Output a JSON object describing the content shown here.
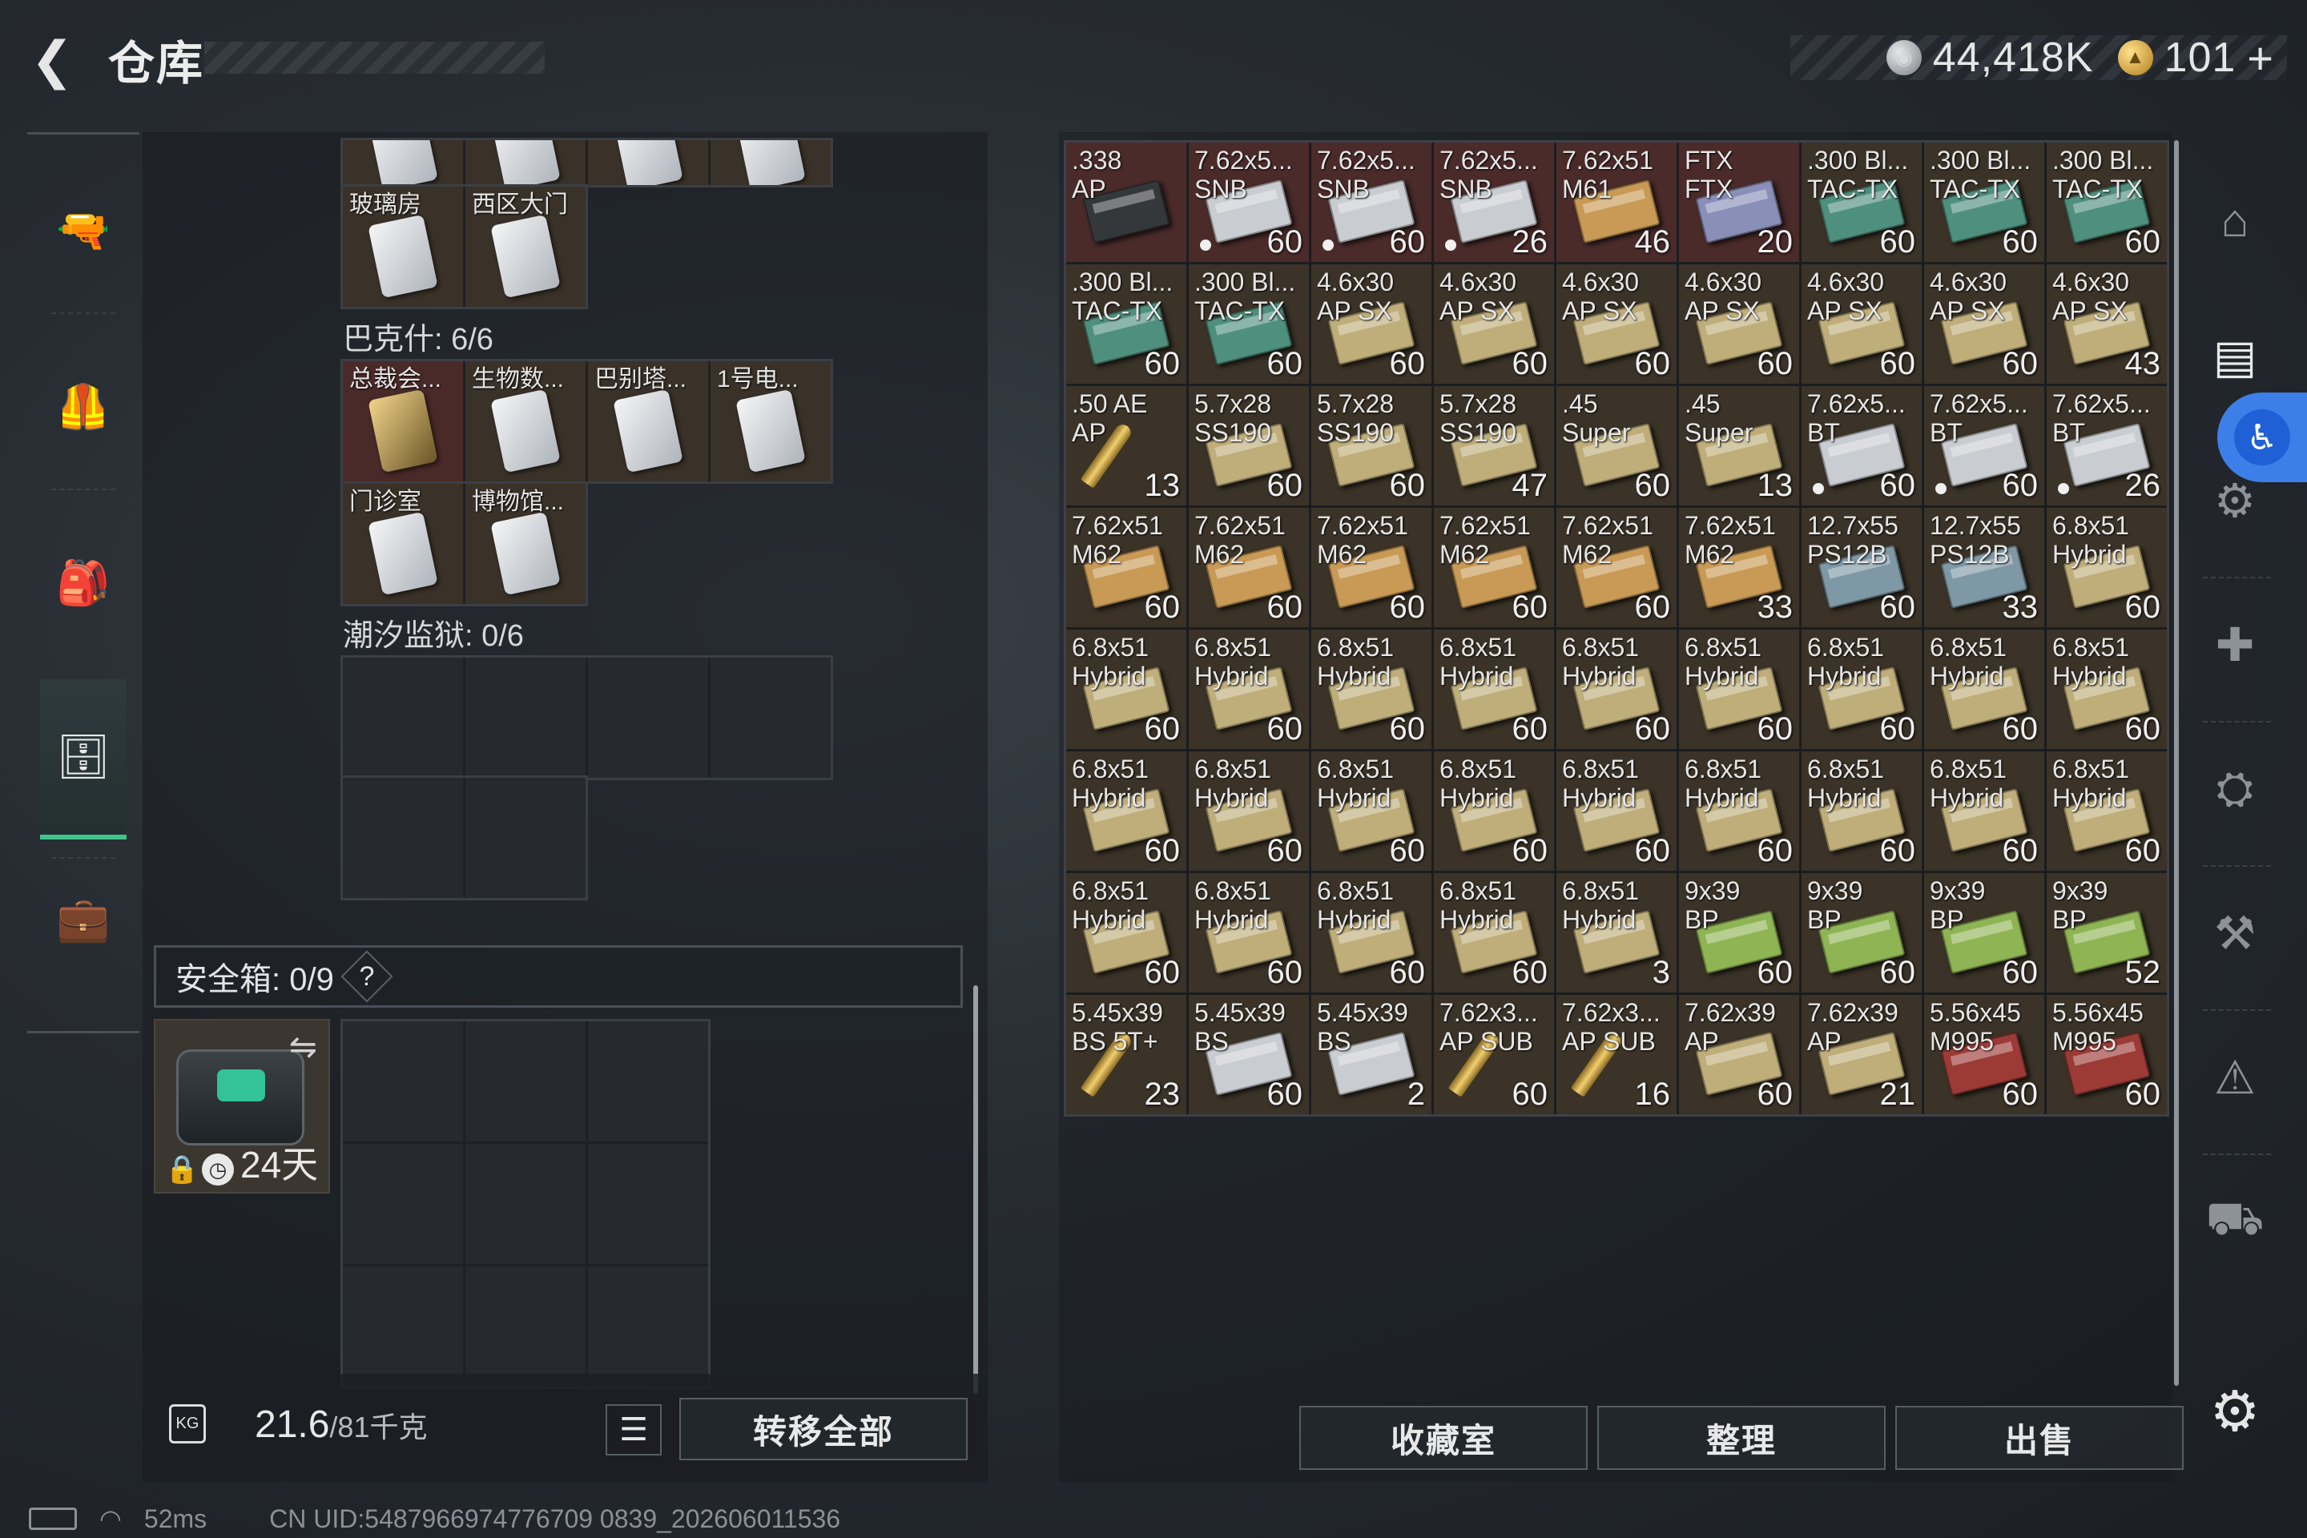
{
  "header": {
    "back_icon": "chevron-left-icon",
    "title": "仓库"
  },
  "currency": {
    "silver_amount": "44,418K",
    "gold_amount": "101",
    "add_label": "+"
  },
  "left_nav": {
    "items": [
      {
        "name": "weapon",
        "icon": "🔫"
      },
      {
        "name": "armor",
        "icon": "🦺"
      },
      {
        "name": "backpack",
        "icon": "🎒"
      },
      {
        "name": "container",
        "icon": "🗄"
      },
      {
        "name": "case",
        "icon": "💼"
      }
    ]
  },
  "keycards": {
    "top_row_labels": [
      "",
      "",
      "",
      ""
    ],
    "row2": [
      "玻璃房",
      "西区大门"
    ],
    "bakshi_label": "巴克什: 6/6",
    "bakshi_row1": [
      "总裁会...",
      "生物数...",
      "巴别塔...",
      "1号电..."
    ],
    "bakshi_row2": [
      "门诊室",
      "博物馆..."
    ],
    "prison_label": "潮汐监狱: 0/6"
  },
  "safe": {
    "label": "安全箱:  0/9",
    "help": "?",
    "days": "24天",
    "swap_icon": "⇋",
    "lock_icon": "🔒",
    "clock_icon": "◷"
  },
  "bottom_left": {
    "weight_icon": "KG",
    "weight_value": "21.6",
    "weight_total": "/81千克",
    "list_icon": "☰",
    "transfer_all": "转移全部"
  },
  "bottom_right": {
    "collection": "收藏室",
    "organize": "整理",
    "sell": "出售"
  },
  "ammo_rows": [
    [
      {
        "l1": ".338",
        "l2": "AP",
        "c": "",
        "k": "dark",
        "red": true
      },
      {
        "l1": "7.62x5...",
        "l2": "SNB",
        "c": "60",
        "k": "silver",
        "red": true,
        "dot": true
      },
      {
        "l1": "7.62x5...",
        "l2": "SNB",
        "c": "60",
        "k": "silver",
        "red": true,
        "dot": true
      },
      {
        "l1": "7.62x5...",
        "l2": "SNB",
        "c": "26",
        "k": "silver",
        "red": true,
        "dot": true
      },
      {
        "l1": "7.62x51",
        "l2": "M61",
        "c": "46",
        "k": "tan",
        "red": true
      },
      {
        "l1": "FTX",
        "l2": "FTX",
        "c": "20",
        "k": "blue",
        "red": true
      },
      {
        "l1": ".300 Bl...",
        "l2": "TAC-TX",
        "c": "60",
        "k": "teal"
      },
      {
        "l1": ".300 Bl...",
        "l2": "TAC-TX",
        "c": "60",
        "k": "teal"
      },
      {
        "l1": ".300 Bl...",
        "l2": "TAC-TX",
        "c": "60",
        "k": "teal"
      }
    ],
    [
      {
        "l1": ".300 Bl...",
        "l2": "TAC-TX",
        "c": "60",
        "k": "teal"
      },
      {
        "l1": ".300 Bl...",
        "l2": "TAC-TX",
        "c": "60",
        "k": "teal"
      },
      {
        "l1": "4.6x30",
        "l2": "AP SX",
        "c": "60",
        "k": "khaki"
      },
      {
        "l1": "4.6x30",
        "l2": "AP SX",
        "c": "60",
        "k": "khaki"
      },
      {
        "l1": "4.6x30",
        "l2": "AP SX",
        "c": "60",
        "k": "khaki"
      },
      {
        "l1": "4.6x30",
        "l2": "AP SX",
        "c": "60",
        "k": "khaki"
      },
      {
        "l1": "4.6x30",
        "l2": "AP SX",
        "c": "60",
        "k": "khaki"
      },
      {
        "l1": "4.6x30",
        "l2": "AP SX",
        "c": "60",
        "k": "khaki"
      },
      {
        "l1": "4.6x30",
        "l2": "AP SX",
        "c": "43",
        "k": "khaki"
      }
    ],
    [
      {
        "l1": ".50 AE",
        "l2": "AP",
        "c": "13",
        "k": "bullet"
      },
      {
        "l1": "5.7x28",
        "l2": "SS190",
        "c": "60",
        "k": "khaki"
      },
      {
        "l1": "5.7x28",
        "l2": "SS190",
        "c": "60",
        "k": "khaki"
      },
      {
        "l1": "5.7x28",
        "l2": "SS190",
        "c": "47",
        "k": "khaki"
      },
      {
        "l1": ".45",
        "l2": "Super",
        "c": "60",
        "k": "khaki"
      },
      {
        "l1": ".45",
        "l2": "Super",
        "c": "13",
        "k": "khaki"
      },
      {
        "l1": "7.62x5...",
        "l2": "BT",
        "c": "60",
        "k": "silver",
        "dot": true
      },
      {
        "l1": "7.62x5...",
        "l2": "BT",
        "c": "60",
        "k": "silver",
        "dot": true
      },
      {
        "l1": "7.62x5...",
        "l2": "BT",
        "c": "26",
        "k": "silver",
        "dot": true
      }
    ],
    [
      {
        "l1": "7.62x51",
        "l2": "M62",
        "c": "60",
        "k": "tan"
      },
      {
        "l1": "7.62x51",
        "l2": "M62",
        "c": "60",
        "k": "tan"
      },
      {
        "l1": "7.62x51",
        "l2": "M62",
        "c": "60",
        "k": "tan"
      },
      {
        "l1": "7.62x51",
        "l2": "M62",
        "c": "60",
        "k": "tan"
      },
      {
        "l1": "7.62x51",
        "l2": "M62",
        "c": "60",
        "k": "tan"
      },
      {
        "l1": "7.62x51",
        "l2": "M62",
        "c": "33",
        "k": "tan"
      },
      {
        "l1": "12.7x55",
        "l2": "PS12B",
        "c": "60",
        "k": "steel"
      },
      {
        "l1": "12.7x55",
        "l2": "PS12B",
        "c": "33",
        "k": "steel"
      },
      {
        "l1": "6.8x51",
        "l2": "Hybrid",
        "c": "60",
        "k": "khaki"
      }
    ],
    [
      {
        "l1": "6.8x51",
        "l2": "Hybrid",
        "c": "60",
        "k": "khaki"
      },
      {
        "l1": "6.8x51",
        "l2": "Hybrid",
        "c": "60",
        "k": "khaki"
      },
      {
        "l1": "6.8x51",
        "l2": "Hybrid",
        "c": "60",
        "k": "khaki"
      },
      {
        "l1": "6.8x51",
        "l2": "Hybrid",
        "c": "60",
        "k": "khaki"
      },
      {
        "l1": "6.8x51",
        "l2": "Hybrid",
        "c": "60",
        "k": "khaki"
      },
      {
        "l1": "6.8x51",
        "l2": "Hybrid",
        "c": "60",
        "k": "khaki"
      },
      {
        "l1": "6.8x51",
        "l2": "Hybrid",
        "c": "60",
        "k": "khaki"
      },
      {
        "l1": "6.8x51",
        "l2": "Hybrid",
        "c": "60",
        "k": "khaki"
      },
      {
        "l1": "6.8x51",
        "l2": "Hybrid",
        "c": "60",
        "k": "khaki"
      }
    ],
    [
      {
        "l1": "6.8x51",
        "l2": "Hybrid",
        "c": "60",
        "k": "khaki"
      },
      {
        "l1": "6.8x51",
        "l2": "Hybrid",
        "c": "60",
        "k": "khaki"
      },
      {
        "l1": "6.8x51",
        "l2": "Hybrid",
        "c": "60",
        "k": "khaki"
      },
      {
        "l1": "6.8x51",
        "l2": "Hybrid",
        "c": "60",
        "k": "khaki"
      },
      {
        "l1": "6.8x51",
        "l2": "Hybrid",
        "c": "60",
        "k": "khaki"
      },
      {
        "l1": "6.8x51",
        "l2": "Hybrid",
        "c": "60",
        "k": "khaki"
      },
      {
        "l1": "6.8x51",
        "l2": "Hybrid",
        "c": "60",
        "k": "khaki"
      },
      {
        "l1": "6.8x51",
        "l2": "Hybrid",
        "c": "60",
        "k": "khaki"
      },
      {
        "l1": "6.8x51",
        "l2": "Hybrid",
        "c": "60",
        "k": "khaki"
      }
    ],
    [
      {
        "l1": "6.8x51",
        "l2": "Hybrid",
        "c": "60",
        "k": "khaki"
      },
      {
        "l1": "6.8x51",
        "l2": "Hybrid",
        "c": "60",
        "k": "khaki"
      },
      {
        "l1": "6.8x51",
        "l2": "Hybrid",
        "c": "60",
        "k": "khaki"
      },
      {
        "l1": "6.8x51",
        "l2": "Hybrid",
        "c": "60",
        "k": "khaki"
      },
      {
        "l1": "6.8x51",
        "l2": "Hybrid",
        "c": "3",
        "k": "khaki"
      },
      {
        "l1": "9x39",
        "l2": "BP",
        "c": "60",
        "k": "green"
      },
      {
        "l1": "9x39",
        "l2": "BP",
        "c": "60",
        "k": "green"
      },
      {
        "l1": "9x39",
        "l2": "BP",
        "c": "60",
        "k": "green"
      },
      {
        "l1": "9x39",
        "l2": "BP",
        "c": "52",
        "k": "green"
      }
    ],
    [
      {
        "l1": "5.45x39",
        "l2": "BS 5T+",
        "c": "23",
        "k": "bullet"
      },
      {
        "l1": "5.45x39",
        "l2": "BS",
        "c": "60",
        "k": "silver"
      },
      {
        "l1": "5.45x39",
        "l2": "BS",
        "c": "2",
        "k": "silver"
      },
      {
        "l1": "7.62x3...",
        "l2": "AP SUB",
        "c": "60",
        "k": "bullet"
      },
      {
        "l1": "7.62x3...",
        "l2": "AP SUB",
        "c": "16",
        "k": "bullet"
      },
      {
        "l1": "7.62x39",
        "l2": "AP",
        "c": "60",
        "k": "khaki"
      },
      {
        "l1": "7.62x39",
        "l2": "AP",
        "c": "21",
        "k": "khaki"
      },
      {
        "l1": "5.56x45",
        "l2": "M995",
        "c": "60",
        "k": "red"
      },
      {
        "l1": "5.56x45",
        "l2": "M995",
        "c": "60",
        "k": "red"
      }
    ]
  ],
  "box_colors": {
    "silver": "#c9cdd1",
    "tan": "#c89a55",
    "teal": "#4f8f7e",
    "khaki": "#bfae7a",
    "green": "#8fb454",
    "steel": "#7e98a6",
    "red": "#9c3b36",
    "blue": "#8a8fb8",
    "dark": "#35383a"
  },
  "right_nav": {
    "items": [
      "⌂",
      "▤",
      "⚙",
      "✚",
      "⛭",
      "⚒",
      "⚠",
      "⛟"
    ],
    "access_icon": "♿",
    "gear_icon": "⚙"
  },
  "status": {
    "ping": "52ms",
    "uid": "CN UID:5487966974776709 0839_202606011536"
  }
}
